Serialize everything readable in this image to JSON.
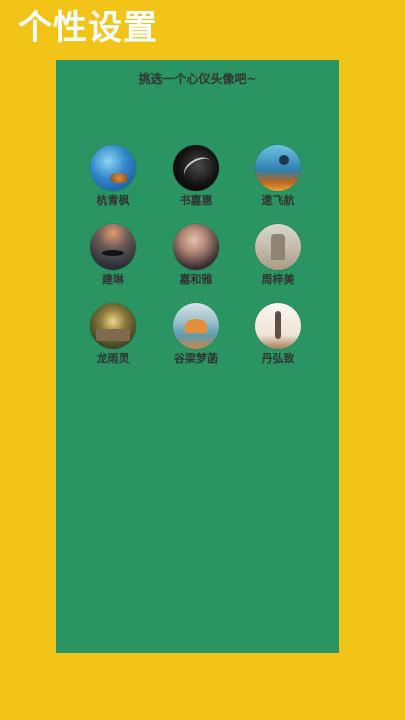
{
  "header": {
    "title": "个性设置"
  },
  "panel": {
    "subtitle": "挑选一个心仪头像吧~",
    "avatars": [
      {
        "name": "杭青枫"
      },
      {
        "name": "书嘉惠"
      },
      {
        "name": "逮飞航"
      },
      {
        "name": "建琳"
      },
      {
        "name": "嘉和雅"
      },
      {
        "name": "周梓美"
      },
      {
        "name": "龙雨灵"
      },
      {
        "name": "谷梁梦菡"
      },
      {
        "name": "丹弘致"
      }
    ]
  },
  "colors": {
    "background": "#f2c417",
    "panel": "#2a9462",
    "title_text": "#ffffff",
    "label_text": "#333333"
  }
}
